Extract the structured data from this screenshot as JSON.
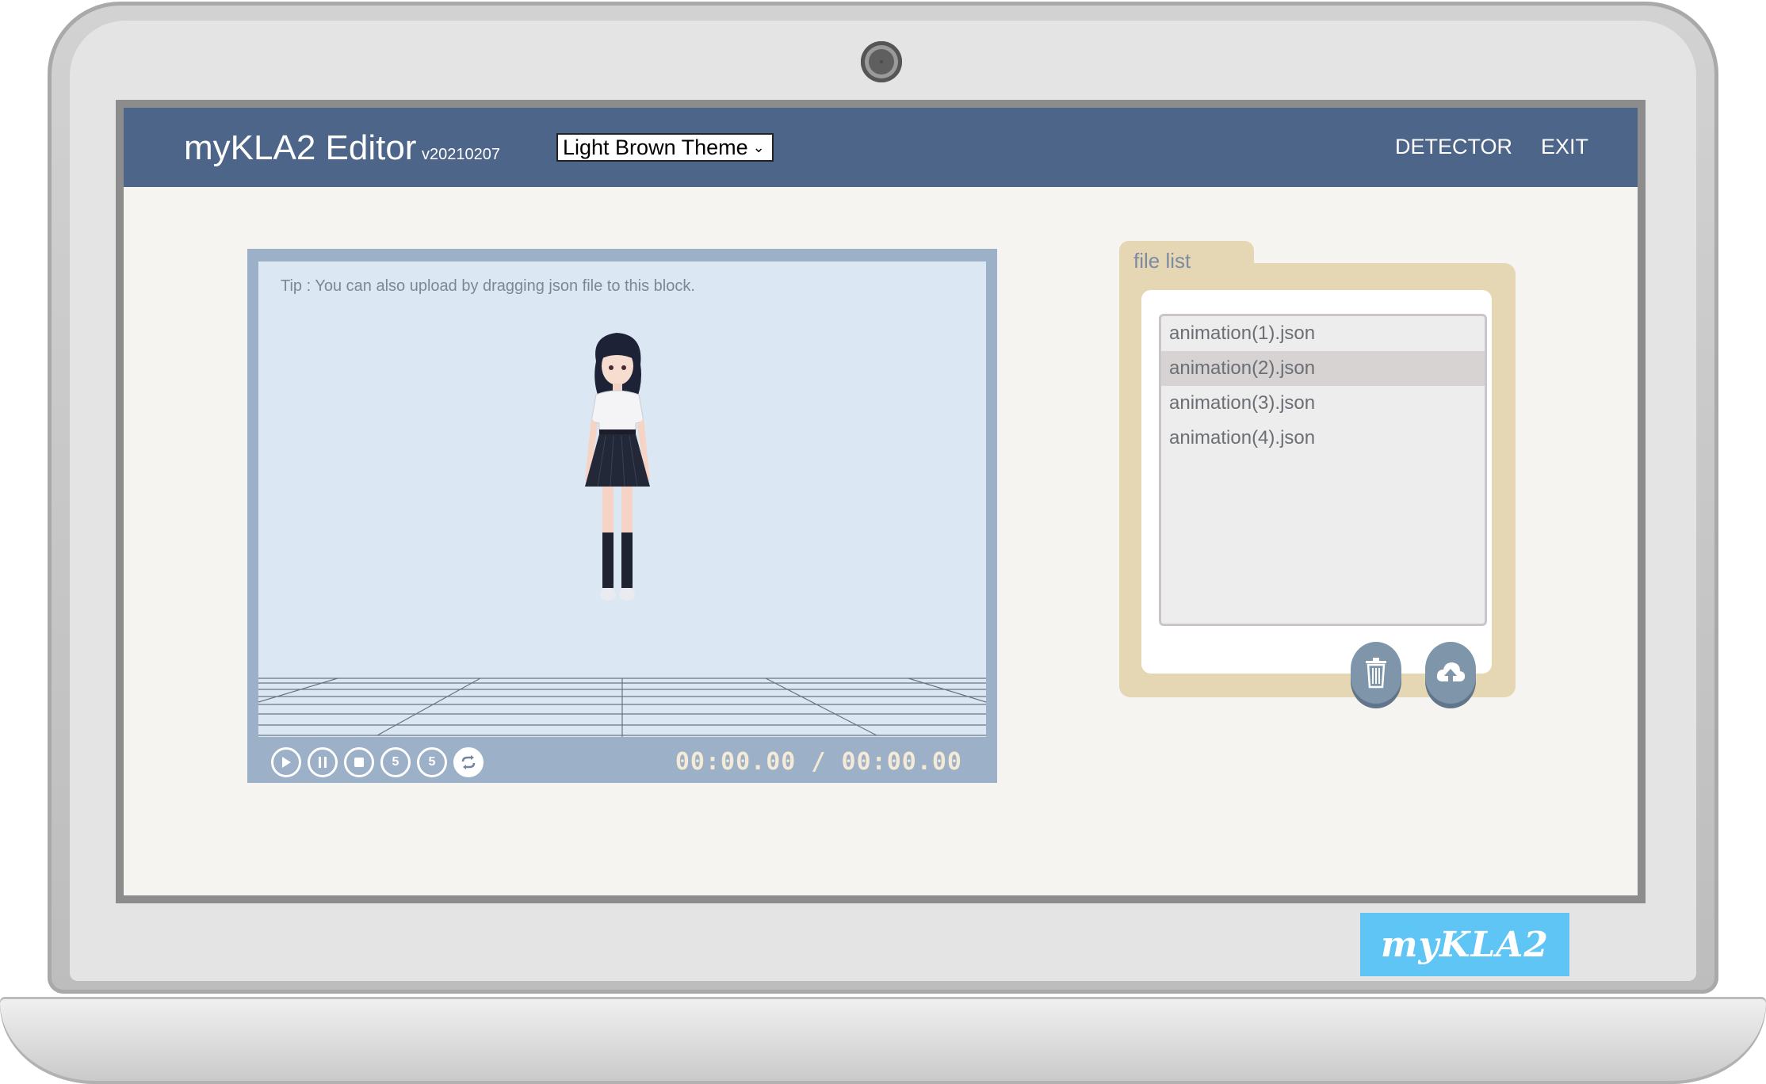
{
  "device": {
    "brand_badge": "myKLA2"
  },
  "header": {
    "app_title": "myKLA2 Editor",
    "version": "v20210207",
    "theme_select": {
      "selected": "Light Brown Theme"
    },
    "nav": {
      "detector": "DETECTOR",
      "exit": "EXIT"
    }
  },
  "viewer": {
    "tip": "Tip : You can also upload by dragging json file to this block.",
    "controls": [
      {
        "name": "play-button",
        "icon": "play-icon"
      },
      {
        "name": "pause-button",
        "icon": "pause-icon"
      },
      {
        "name": "stop-button",
        "icon": "stop-icon"
      },
      {
        "name": "rewind-5-button",
        "icon": "rewind-5-icon",
        "label": "5"
      },
      {
        "name": "forward-5-button",
        "icon": "forward-5-icon",
        "label": "5"
      },
      {
        "name": "loop-button",
        "icon": "loop-icon"
      }
    ],
    "timecode": "00:00.00 / 00:00.00"
  },
  "file_list": {
    "title": "file list",
    "items": [
      {
        "label": "animation(1).json",
        "selected": false
      },
      {
        "label": "animation(2).json",
        "selected": true
      },
      {
        "label": "animation(3).json",
        "selected": false
      },
      {
        "label": "animation(4).json",
        "selected": false
      }
    ],
    "actions": [
      {
        "name": "delete-button",
        "icon": "trash-icon"
      },
      {
        "name": "upload-button",
        "icon": "cloud-upload-icon"
      }
    ]
  },
  "colors": {
    "topbar": "#4d6588",
    "panel": "#e6d7b4",
    "viewer_frame": "#9cb0c8",
    "stage": "#dbe8f3",
    "badge": "#5ec5f4"
  }
}
